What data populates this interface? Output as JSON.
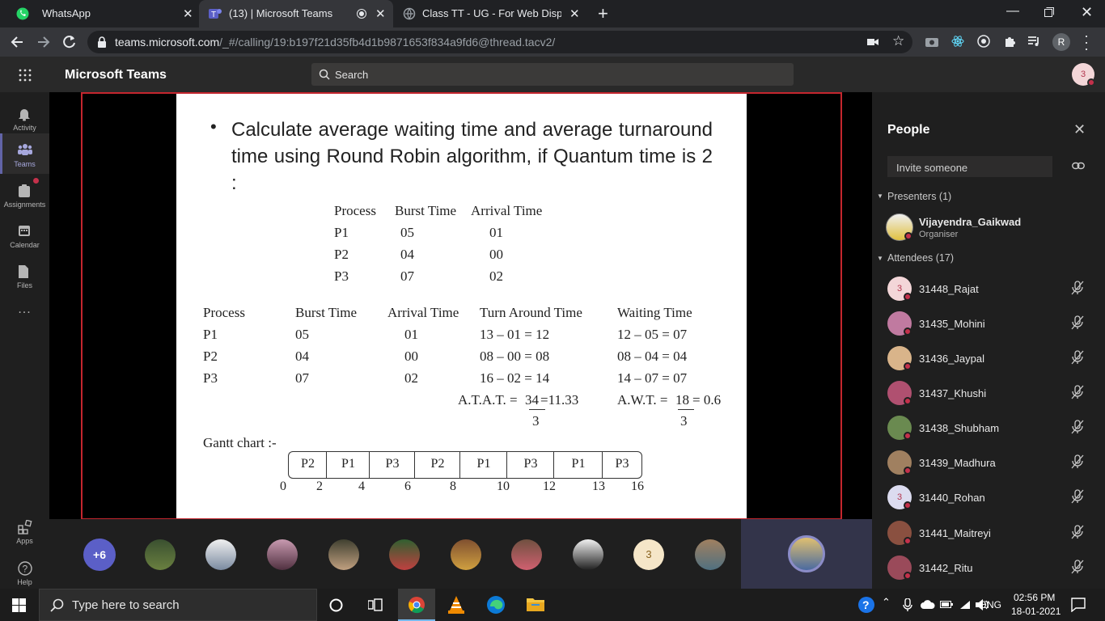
{
  "browser": {
    "tabs": [
      {
        "title": "WhatsApp",
        "close": "✕"
      },
      {
        "title": "(13) | Microsoft Teams",
        "close": "✕"
      },
      {
        "title": "Class TT - UG - For Web Display",
        "close": "✕"
      }
    ],
    "new_tab": "+",
    "url_host": "teams.microsoft.com",
    "url_path": "/_#/calling/19:b197f21d35fb4d1b9871653f834a9fd6@thread.tacv2/",
    "profile_initial": "R"
  },
  "teams": {
    "app_title": "Microsoft Teams",
    "search_placeholder": "Search",
    "me_avatar": "3"
  },
  "rail": [
    {
      "label": "Activity"
    },
    {
      "label": "Teams"
    },
    {
      "label": "Assignments"
    },
    {
      "label": "Calendar"
    },
    {
      "label": "Files"
    },
    {
      "label": "..."
    },
    {
      "label": "Apps"
    },
    {
      "label": "Help"
    }
  ],
  "slide": {
    "bullet": "•",
    "question": "Calculate average waiting time and average turnaround time using Round Robin algorithm, if Quantum time is 2 :",
    "table1": {
      "headers": [
        "Process",
        "Burst Time",
        "Arrival Time"
      ],
      "rows": [
        [
          "P1",
          "05",
          "01"
        ],
        [
          "P2",
          "04",
          "00"
        ],
        [
          "P3",
          "07",
          "02"
        ]
      ]
    },
    "table2": {
      "headers": [
        "Process",
        "Burst Time",
        "Arrival Time",
        "Turn Around Time",
        "Waiting Time"
      ],
      "rows": [
        [
          "P1",
          "05",
          "01",
          "13 – 01 = 12",
          "12 – 05 = 07"
        ],
        [
          "P2",
          "04",
          "00",
          "08 – 00 = 08",
          "08 – 04 = 04"
        ],
        [
          "P3",
          "07",
          "02",
          "16 – 02 = 14",
          "14 – 07 = 07"
        ]
      ]
    },
    "atat_label": "A.T.A.T. =",
    "atat_num": "34",
    "atat_res": "=11.33",
    "atat_den": "3",
    "awt_label": "A.W.T. =",
    "awt_num": "18",
    "awt_res": "= 0.6",
    "awt_den": "3",
    "gantt_label": "Gantt chart :-",
    "gantt_cells": [
      "P2",
      "P1",
      "P3",
      "P2",
      "P1",
      "P3",
      "P1",
      "P3"
    ],
    "gantt_times": [
      "0",
      "2",
      "4",
      "6",
      "8",
      "10",
      "12",
      "13",
      "16"
    ]
  },
  "strip": {
    "overflow": "+6",
    "text_avatar": "3"
  },
  "people": {
    "title": "People",
    "invite_placeholder": "Invite someone",
    "presenters_label": "Presenters (1)",
    "presenter": {
      "name": "Vijayendra_Gaikwad",
      "role": "Organiser"
    },
    "attendees_label": "Attendees (17)",
    "attendees": [
      {
        "name": "31448_Rajat",
        "initial": "3",
        "color": "#f3d6d8"
      },
      {
        "name": "31435_Mohini",
        "initial": "",
        "color": "#c07aa0"
      },
      {
        "name": "31436_Jaypal",
        "initial": "",
        "color": "#d9b48a"
      },
      {
        "name": "31437_Khushi",
        "initial": "",
        "color": "#b05070"
      },
      {
        "name": "31438_Shubham",
        "initial": "",
        "color": "#6a8a50"
      },
      {
        "name": "31439_Madhura",
        "initial": "",
        "color": "#a08060"
      },
      {
        "name": "31440_Rohan",
        "initial": "3",
        "color": "#dcdcf0"
      },
      {
        "name": "31441_Maitreyi",
        "initial": "",
        "color": "#8a5040"
      },
      {
        "name": "31442_Ritu",
        "initial": "",
        "color": "#9a4a5a"
      }
    ]
  },
  "taskbar": {
    "search_placeholder": "Type here to search",
    "lang": "ENG",
    "time": "02:56 PM",
    "date": "18-01-2021"
  },
  "colors": {
    "accent": "#6264a7",
    "share_border": "#c4262e",
    "status_red": "#c4314b"
  }
}
